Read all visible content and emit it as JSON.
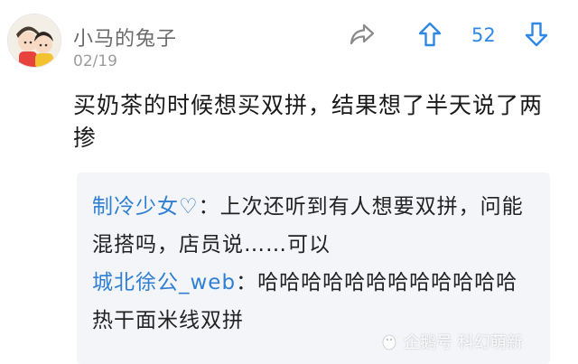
{
  "post": {
    "username": "小马的兔子",
    "date": "02/19",
    "vote_count": "52",
    "text": "买奶茶的时候想买双拼，结果想了半天说了两掺"
  },
  "replies": [
    {
      "user": "制冷少女♡",
      "sep": "：",
      "text": "上次还听到有人想要双拼，问能混搭吗，店员说……可以"
    },
    {
      "user": "城北徐公_web",
      "sep": "：",
      "text": "哈哈哈哈哈哈哈哈哈哈哈哈热干面米线双拼"
    }
  ],
  "watermark": {
    "text": "企鹅号 科幻萌新"
  },
  "icons": {
    "share": "share-arrow-icon",
    "upvote": "arrow-up-icon",
    "downvote": "arrow-down-icon",
    "watermark_logo": "penguin-logo-icon"
  },
  "colors": {
    "accent": "#2f87e6",
    "reply_user": "#2f7fd3",
    "reply_bg": "#f3f5f9"
  }
}
